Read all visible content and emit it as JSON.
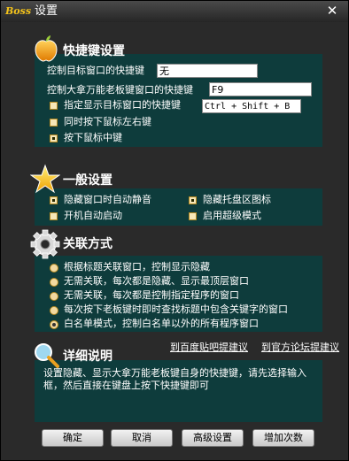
{
  "window": {
    "app_logo": "Boss",
    "title": "设置"
  },
  "hotkey": {
    "title": "快捷键设置",
    "row1_label": "控制目标窗口的快捷键",
    "row1_value": "无",
    "row2_label": "控制大拿万能老板键窗口的快捷键",
    "row2_value": "F9",
    "row3_label": "指定显示目标窗口的快捷键",
    "row3_value": "Ctrl + Shift + B",
    "row4_label": "同时按下鼠标左右键",
    "row5_label": "按下鼠标中键"
  },
  "general": {
    "title": "一般设置",
    "opt1": "隐藏窗口时自动静音",
    "opt2": "隐藏托盘区图标",
    "opt3": "开机自动启动",
    "opt4": "启用超级模式"
  },
  "assoc": {
    "title": "关联方式",
    "options": [
      "根据标题关联窗口，控制显示隐藏",
      "无需关联，每次都是隐藏、显示最顶层窗口",
      "无需关联，每次都是控制指定程序的窗口",
      "每次按下老板键时即时查找标题中包含关键字的窗口",
      "白名单模式，控制白名单以外的所有程序窗口"
    ]
  },
  "detail": {
    "title": "详细说明",
    "link1": "到百度贴吧提建议",
    "link2": "到官方论坛提建议",
    "text": "设置隐藏、显示大拿万能老板键自身的快捷键，请先选择输入框，然后直接在键盘上按下快捷键即可"
  },
  "buttons": {
    "ok": "确定",
    "cancel": "取消",
    "advanced": "高级设置",
    "add": "增加次数"
  }
}
